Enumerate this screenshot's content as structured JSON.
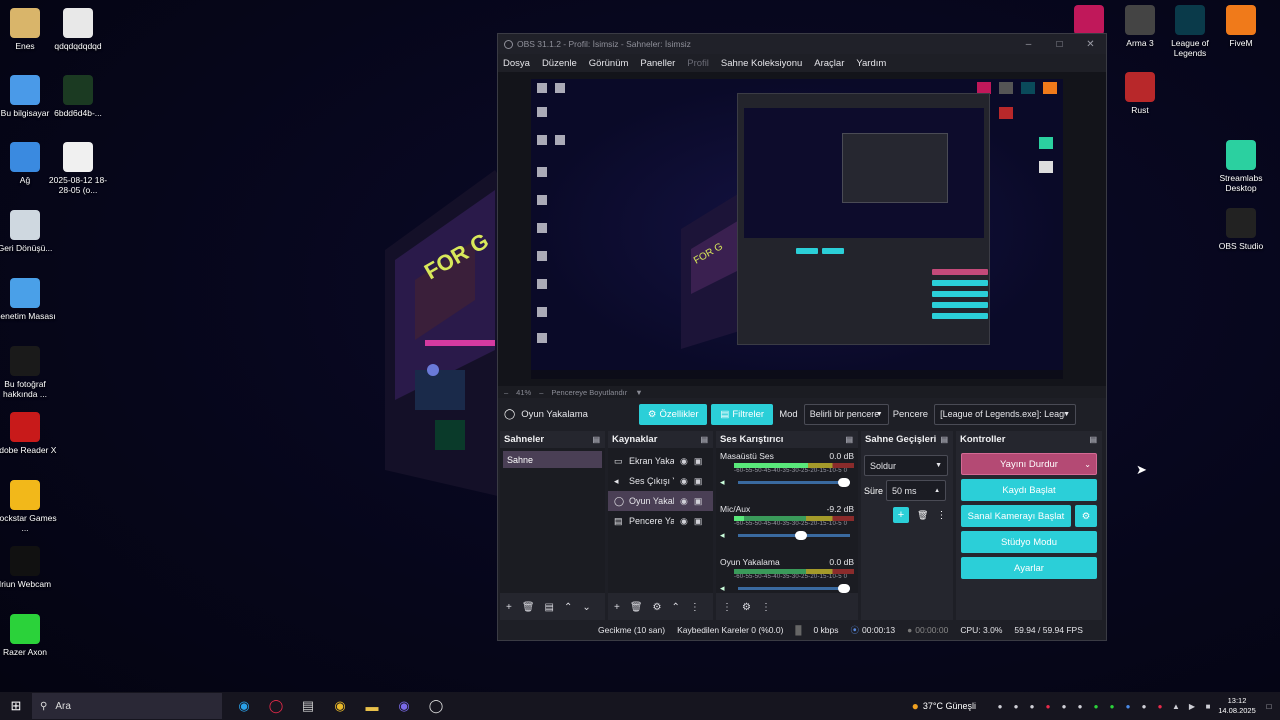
{
  "desktop_left": [
    {
      "label": "Enes",
      "icon": "user-folder-icon",
      "color": "#d9b56a"
    },
    {
      "label": "qdqdqdqdqd",
      "icon": "image-file-icon",
      "color": "#e8e8e8"
    },
    {
      "label": "Bu bilgisayar",
      "icon": "computer-icon",
      "color": "#4a9ae8"
    },
    {
      "label": "6bdd6d4b-...",
      "icon": "file-icon",
      "color": "#1b3a22"
    },
    {
      "label": "Ağ",
      "icon": "network-icon",
      "color": "#3a8ae0"
    },
    {
      "label": "2025-08-12 18-28-05 (o...",
      "icon": "video-file-icon",
      "color": "#f0f0f0"
    },
    {
      "label": "Geri Dönüşü...",
      "icon": "recycle-bin-icon",
      "color": "#cfd8e0"
    },
    {
      "label": "Denetim Masası",
      "icon": "control-panel-icon",
      "color": "#4aa0e8"
    },
    {
      "label": "Bu fotoğraf hakkında ...",
      "icon": "photo-info-icon",
      "color": "#1a1a1a"
    },
    {
      "label": "Adobe Reader X",
      "icon": "adobe-reader-icon",
      "color": "#c81a1a"
    },
    {
      "label": "Rockstar Games ...",
      "icon": "rockstar-icon",
      "color": "#f2b81a"
    },
    {
      "label": "Iriun Webcam",
      "icon": "webcam-icon",
      "color": "#111111"
    },
    {
      "label": "Razer Axon",
      "icon": "razer-icon",
      "color": "#2bd23a"
    }
  ],
  "desktop_right": [
    {
      "label": "",
      "icon": "forza-icon",
      "color": "#c0185a"
    },
    {
      "label": "Arma 3",
      "icon": "arma-icon",
      "color": "#444444"
    },
    {
      "label": "League of Legends",
      "icon": "league-icon",
      "color": "#0a3a4a"
    },
    {
      "label": "FiveM",
      "icon": "fivem-icon",
      "color": "#f07a1a"
    },
    {
      "label": "Rust",
      "icon": "rust-icon",
      "color": "#b8282a"
    },
    {
      "label": "Streamlabs Desktop",
      "icon": "streamlabs-icon",
      "color": "#2bd0a0"
    },
    {
      "label": "OBS Studio",
      "icon": "obs-icon",
      "color": "#222222"
    }
  ],
  "obs": {
    "title": "OBS 31.1.2 - Profil: İsimsiz - Sahneler: İsimsiz",
    "menu": [
      "Dosya",
      "Düzenle",
      "Görünüm",
      "Paneller",
      "Profil",
      "Sahne Koleksiyonu",
      "Araçlar",
      "Yardım"
    ],
    "zoom": "41%",
    "zoom_mode": "Pencereye Boyutlandır",
    "source_name": "Oyun Yakalama",
    "properties_btn": "Özellikler",
    "filters_btn": "Filtreler",
    "mode_label": "Mod",
    "mode_value": "Belirli bir pencereyi yakala",
    "window_label": "Pencere",
    "window_value": "[League of Legends.exe]: League of Legends",
    "scenes": {
      "title": "Sahneler",
      "items": [
        "Sahne"
      ]
    },
    "sources": {
      "title": "Kaynaklar",
      "items": [
        {
          "name": "Ekran Yakalama",
          "icon": "monitor-icon"
        },
        {
          "name": "Ses Çıkışı Yakalama",
          "icon": "speaker-icon"
        },
        {
          "name": "Oyun Yakalama",
          "icon": "gamepad-icon"
        },
        {
          "name": "Pencere Yakalama",
          "icon": "window-icon"
        }
      ]
    },
    "mixer": {
      "title": "Ses Karıştırıcı",
      "channels": [
        {
          "name": "Masaüstü Ses",
          "db": "0.0 dB",
          "level": 0.62,
          "volume": 1.0
        },
        {
          "name": "Mic/Aux",
          "db": "-9.2 dB",
          "level": 0.08,
          "volume": 0.62
        },
        {
          "name": "Oyun Yakalama",
          "db": "0.0 dB",
          "level": 0.0,
          "volume": 1.0
        }
      ],
      "scale": "-60-55-50-45-40-35-30-25-20-15-10-5 0"
    },
    "transitions": {
      "title": "Sahne Geçişleri",
      "type": "Soldur",
      "duration_label": "Süre",
      "duration": "50 ms"
    },
    "controls": {
      "title": "Kontroller",
      "stop_stream": "Yayını Durdur",
      "start_record": "Kaydı Başlat",
      "virtual_cam": "Sanal Kamerayı Başlat",
      "studio_mode": "Stüdyo Modu",
      "settings": "Ayarlar"
    },
    "status": {
      "delay": "Gecikme (10 san)",
      "dropped": "Kaybedilen Kareler 0 (%0.0)",
      "kbps": "0 kbps",
      "stream_time": "00:00:13",
      "rec_time": "00:00:00",
      "cpu": "CPU: 3.0%",
      "fps": "59.94 / 59.94 FPS"
    },
    "accent": "#2bcfd8"
  },
  "taskbar": {
    "search": "Ara",
    "weather": "37°C Güneşli",
    "time": "13:12",
    "date": "14.08.2025"
  }
}
